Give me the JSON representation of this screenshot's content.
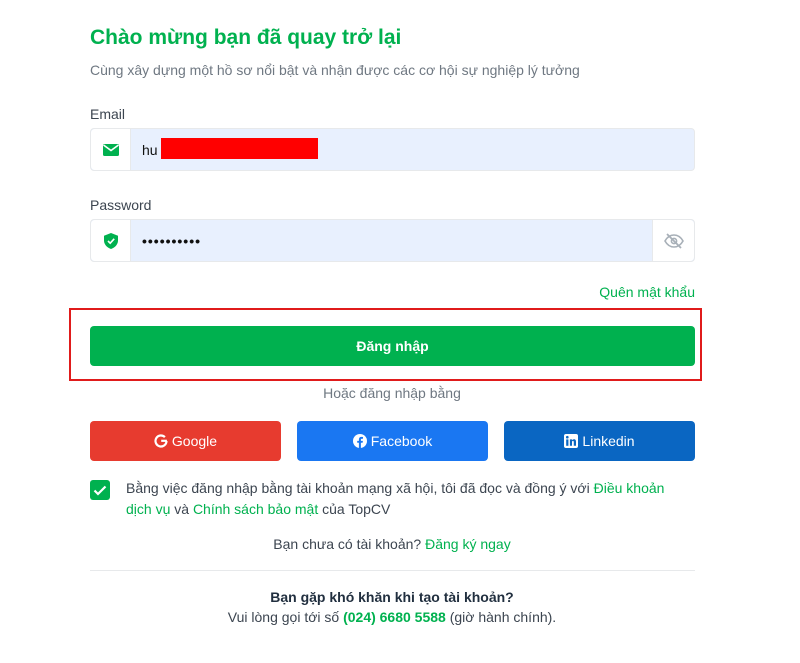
{
  "header": {
    "title": "Chào mừng bạn đã quay trở lại",
    "subtitle": "Cùng xây dựng một hồ sơ nổi bật và nhận được các cơ hội sự nghiệp lý tưởng"
  },
  "form": {
    "email_label": "Email",
    "email_value": "hu",
    "password_label": "Password",
    "password_value": "••••••••••",
    "forgot_link": "Quên mật khẩu",
    "login_button": "Đăng nhập"
  },
  "social": {
    "or_text": "Hoặc đăng nhập bằng",
    "google": "Google",
    "facebook": "Facebook",
    "linkedin": "Linkedin"
  },
  "terms": {
    "prefix": "Bằng việc đăng nhập bằng tài khoản mạng xã hội, tôi đã đọc và đồng ý với",
    "terms_link": "Điều khoản dịch vụ",
    "and": "và",
    "privacy_link": "Chính sách bảo mật",
    "suffix": "của TopCV"
  },
  "signup": {
    "question": "Bạn chưa có tài khoản?",
    "link": "Đăng ký ngay"
  },
  "help": {
    "title": "Bạn gặp khó khăn khi tạo tài khoản?",
    "prefix": "Vui lòng gọi tới số",
    "phone": "(024) 6680 5588",
    "suffix": "(giờ hành chính)."
  },
  "colors": {
    "brand_green": "#00b14f",
    "google": "#e73b2f",
    "facebook": "#1a77f2",
    "linkedin": "#0a66c2",
    "highlight": "#e01b1b",
    "input_bg": "#e8f0fe"
  },
  "icons": {
    "email": "envelope-icon",
    "password": "shield-icon",
    "toggle": "eye-slash-icon"
  }
}
